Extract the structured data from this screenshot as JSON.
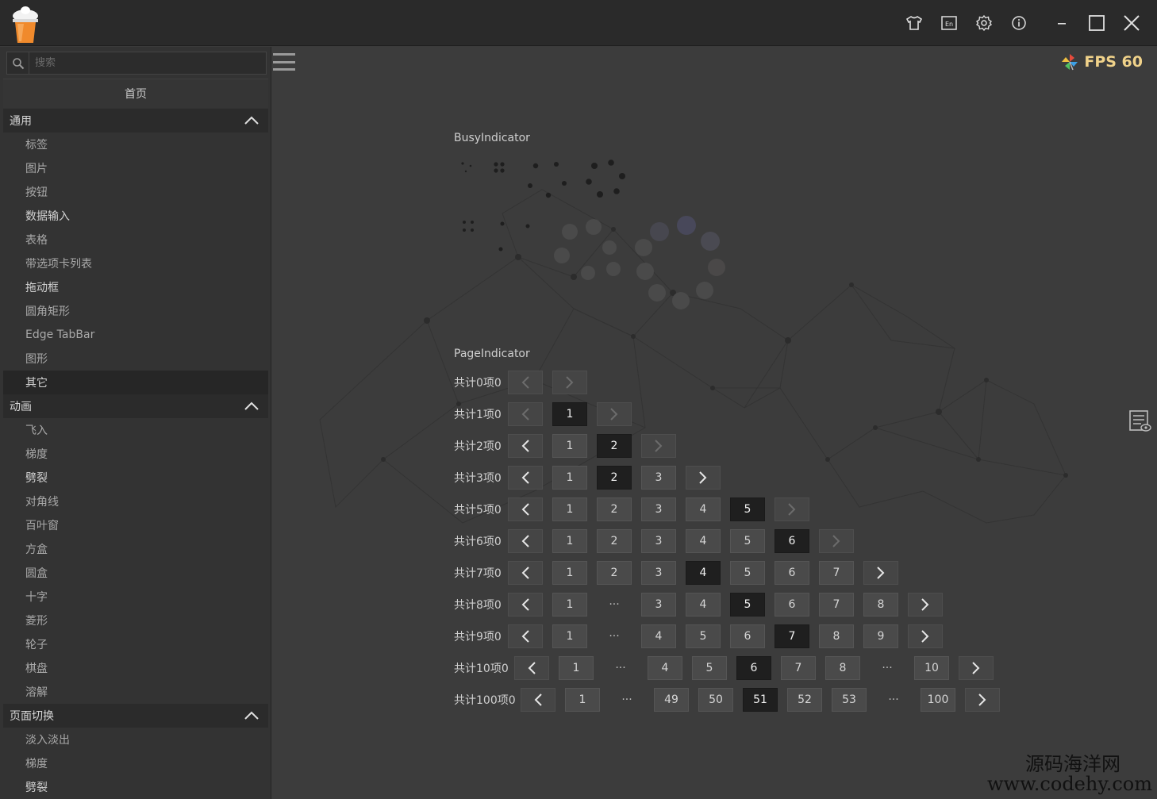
{
  "titlebar": {
    "icons": [
      "shirt-icon",
      "language-icon",
      "gear-icon",
      "info-icon",
      "minimize-icon",
      "maximize-icon",
      "close-icon"
    ],
    "language_badge": "En"
  },
  "sidebar": {
    "search_placeholder": "搜索",
    "home": "首页",
    "groups": [
      {
        "title": "通用",
        "items": [
          "标签",
          "图片",
          "按钮",
          "数据输入",
          "表格",
          "带选项卡列表",
          "拖动框",
          "圆角矩形",
          "Edge TabBar",
          "图形",
          "其它"
        ]
      },
      {
        "title": "动画",
        "items": [
          "飞入",
          "梯度",
          "劈裂",
          "对角线",
          "百叶窗",
          "方盒",
          "圆盒",
          "十字",
          "菱形",
          "轮子",
          "棋盘",
          "溶解"
        ]
      },
      {
        "title": "页面切换",
        "items": [
          "淡入淡出",
          "梯度",
          "劈裂"
        ]
      }
    ]
  },
  "main": {
    "fps": "FPS 60",
    "busy_title": "BusyIndicator",
    "pager_title": "PageIndicator",
    "pagers": [
      {
        "label": "共计0项0",
        "pages": []
      },
      {
        "label": "共计1项0",
        "pages": [
          "1"
        ],
        "current": "1"
      },
      {
        "label": "共计2项0",
        "pages": [
          "1",
          "2"
        ],
        "current": "2"
      },
      {
        "label": "共计3项0",
        "pages": [
          "1",
          "2",
          "3"
        ],
        "current": "2"
      },
      {
        "label": "共计5项0",
        "pages": [
          "1",
          "2",
          "3",
          "4",
          "5"
        ],
        "current": "5"
      },
      {
        "label": "共计6项0",
        "pages": [
          "1",
          "2",
          "3",
          "4",
          "5",
          "6"
        ],
        "current": "6"
      },
      {
        "label": "共计7项0",
        "pages": [
          "1",
          "2",
          "3",
          "4",
          "5",
          "6",
          "7"
        ],
        "current": "4"
      },
      {
        "label": "共计8项0",
        "pages": [
          "1",
          "···",
          "3",
          "4",
          "5",
          "6",
          "7",
          "8"
        ],
        "current": "5"
      },
      {
        "label": "共计9项0",
        "pages": [
          "1",
          "···",
          "4",
          "5",
          "6",
          "7",
          "8",
          "9"
        ],
        "current": "7"
      },
      {
        "label": "共计10项0",
        "pages": [
          "1",
          "···",
          "4",
          "5",
          "6",
          "7",
          "8",
          "···",
          "10"
        ],
        "current": "6"
      },
      {
        "label": "共计100项0",
        "pages": [
          "1",
          "···",
          "49",
          "50",
          "51",
          "52",
          "53",
          "···",
          "100"
        ],
        "current": "51"
      }
    ]
  },
  "watermark": {
    "line1": "源码海洋网",
    "line2": "www.codehy.com"
  },
  "colors": {
    "accent_fps": "#f0d28a",
    "current_page_bg": "#1f1f1f",
    "sidebar_bg": "#333333",
    "titlebar_bg": "#2a2a2a"
  }
}
